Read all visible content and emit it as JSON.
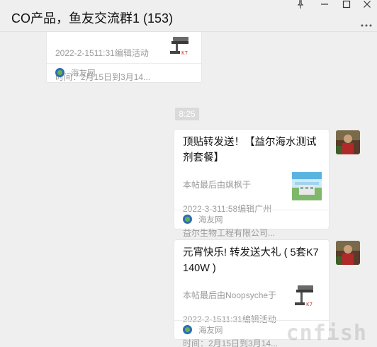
{
  "window": {
    "title": "CO产品，鱼友交流群1 (153)",
    "controls": {
      "pin": "pin-icon",
      "minimize": "minimize-icon",
      "maximize": "maximize-icon",
      "close": "close-icon",
      "more": "more-icon"
    }
  },
  "chat": {
    "time_divider": "8:25",
    "messages": [
      {
        "title": "",
        "desc_lines": [
          "2022-2-1511:31编辑活动",
          "时间：2月15日到3月14..."
        ],
        "source": "海友网"
      },
      {
        "title": "顶贴转发送！【益尔海水测试剂套餐】",
        "desc_lines": [
          "本帖最后由飒枫于",
          "2022-3-311:58编辑广州",
          "益尔生物工程有限公司..."
        ],
        "source": "海友网"
      },
      {
        "title": "元宵快乐! 转发送大礼 ( 5套K7 140W )",
        "desc_lines": [
          "本帖最后由Noopsyche于",
          "2022-2-1511:31编辑活动",
          "时间：2月15日到3月14..."
        ],
        "source": "海友网"
      }
    ]
  },
  "watermark": "cnfish"
}
